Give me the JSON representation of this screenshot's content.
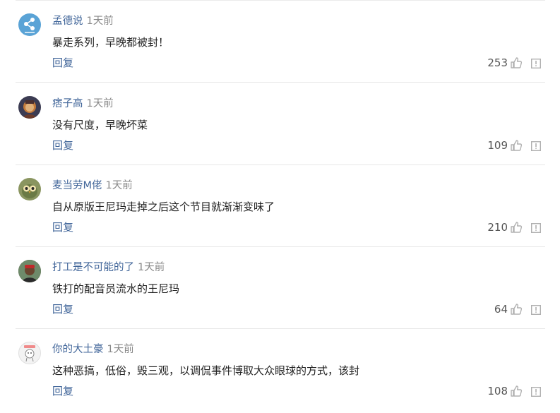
{
  "comments": [
    {
      "username": "孟德说",
      "time": "1天前",
      "text": "暴走系列，早晚都被封！",
      "reply_label": "回复",
      "likes": "253",
      "avatar_icon": "share-icon",
      "avatar_color": "#5aa3d6"
    },
    {
      "username": "痞子高",
      "time": "1天前",
      "text": "没有尺度，早晚坏菜",
      "reply_label": "回复",
      "likes": "109",
      "avatar_icon": "user-photo-icon",
      "avatar_color": "#3b3b52"
    },
    {
      "username": "麦当劳M佬",
      "time": "1天前",
      "text": "自从原版王尼玛走掉之后这个节目就渐渐变味了",
      "reply_label": "回复",
      "likes": "210",
      "avatar_icon": "owl-icon",
      "avatar_color": "#8a9560"
    },
    {
      "username": "打工是不可能的了",
      "time": "1天前",
      "text": "铁打的配音员流水的王尼玛",
      "reply_label": "回复",
      "likes": "64",
      "avatar_icon": "user-photo-icon",
      "avatar_color": "#5a4a3a"
    },
    {
      "username": "你的大土豪",
      "time": "1天前",
      "text": "这种恶搞，低俗，毁三观，以调侃事件博取大众眼球的方式，该封",
      "reply_label": "回复",
      "likes": "108",
      "avatar_icon": "cartoon-avatar-icon",
      "avatar_color": "#f3f3f3"
    }
  ],
  "colors": {
    "username": "#406599",
    "reply": "#406599",
    "time": "#888888",
    "text": "#222222",
    "icon": "#b0b0b0"
  }
}
